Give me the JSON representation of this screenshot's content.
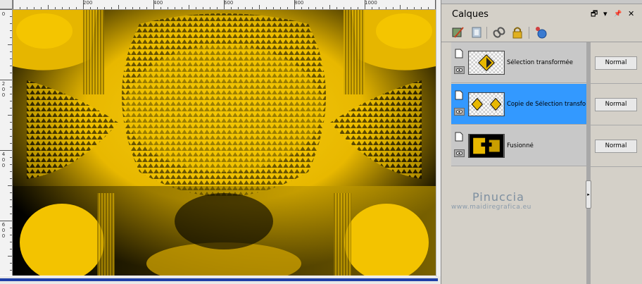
{
  "ruler": {
    "top_labels": [
      "200",
      "400",
      "600",
      "800",
      "1000"
    ],
    "left_labels": [
      "0",
      "2",
      "0",
      "0",
      "4",
      "0",
      "0",
      "6",
      "0",
      "0"
    ]
  },
  "layers_panel": {
    "title": "Calques",
    "header_buttons": {
      "dock": "🗗",
      "menu": "▾",
      "pin": "📌",
      "close": "✕"
    },
    "toolbar_icons": [
      "layer-properties-icon",
      "mask-icon",
      "link-icon",
      "lock-icon",
      "new-layer-icon"
    ],
    "layers": [
      {
        "name": "Sélection transformée",
        "blend": "Normal",
        "selected": false
      },
      {
        "name": "Copie de Sélection transformée",
        "blend": "Normal",
        "selected": true
      },
      {
        "name": "Fusionné",
        "blend": "Normal",
        "selected": false
      }
    ]
  },
  "watermark": {
    "name": "Pinuccia",
    "url": "www.maidiregrafica.eu"
  },
  "colors": {
    "accent_selected": "#3399ff",
    "image_yellow": "#f3c300",
    "image_black": "#000000",
    "scroll_blue": "#1f3fa8"
  }
}
